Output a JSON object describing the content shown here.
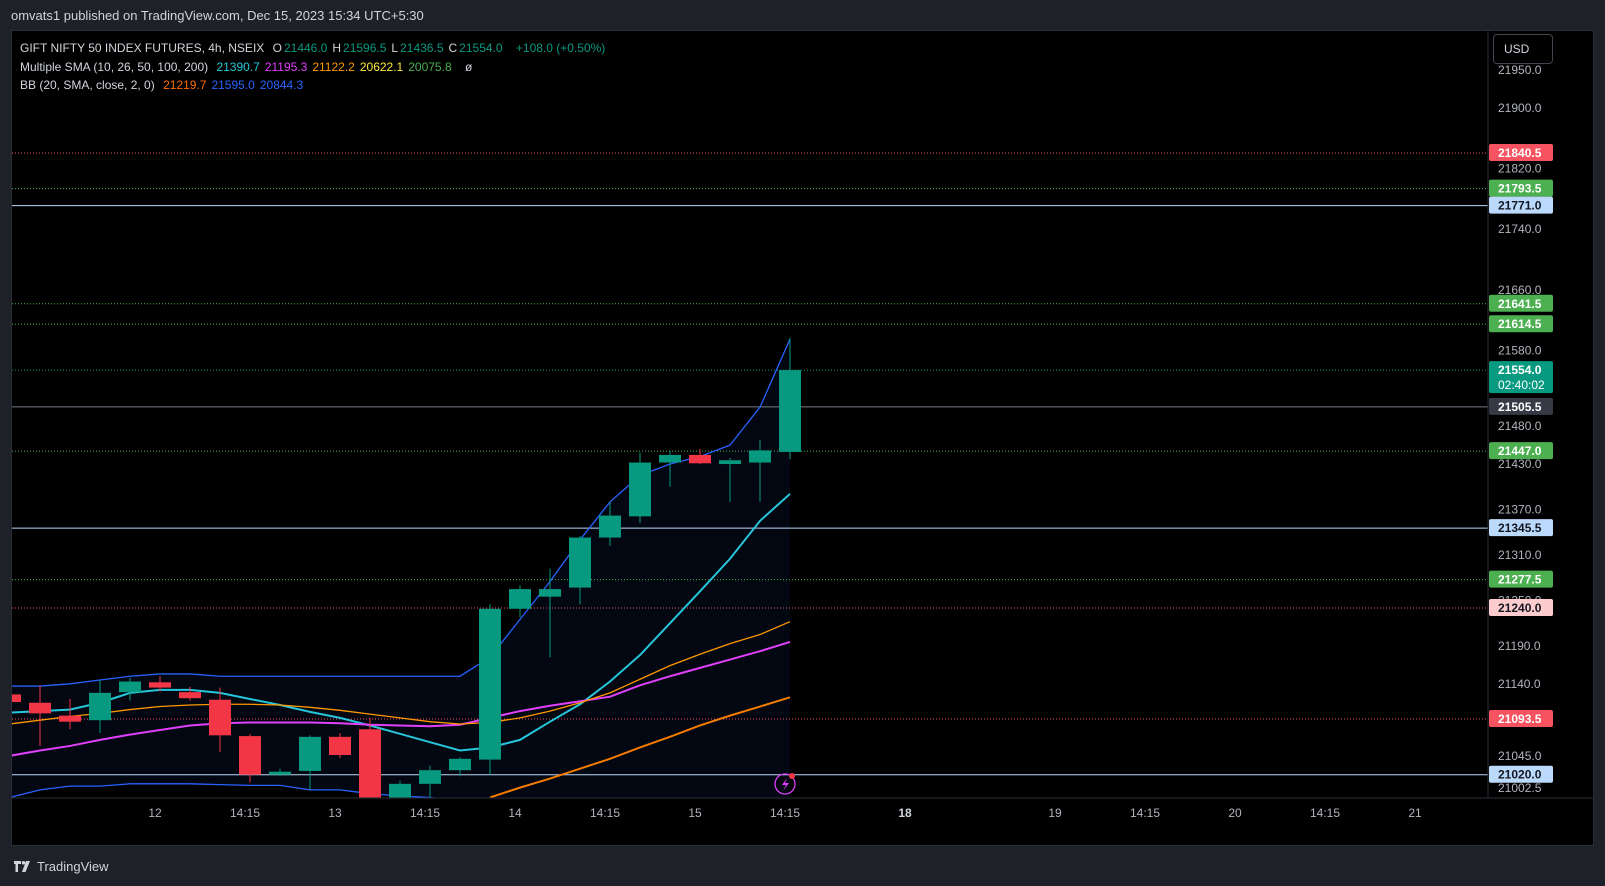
{
  "header": {
    "publisher_text": "omvats1 published on TradingView.com, Dec 15, 2023 15:34 UTC+5:30"
  },
  "legend": {
    "symbol": "GIFT NIFTY 50 INDEX FUTURES, 4h, NSEIX",
    "ohlc": [
      {
        "label": "O",
        "value": "21446.0"
      },
      {
        "label": "H",
        "value": "21596.5"
      },
      {
        "label": "L",
        "value": "21436.5"
      },
      {
        "label": "C",
        "value": "21554.0"
      }
    ],
    "change": "+108.0 (+0.50%)",
    "sma_label": "Multiple SMA (10, 26, 50, 100, 200)",
    "sma_values": [
      {
        "value": "21390.7",
        "color": "#26c6da"
      },
      {
        "value": "21195.3",
        "color": "#e040fb"
      },
      {
        "value": "21122.2",
        "color": "#ff9800"
      },
      {
        "value": "20622.1",
        "color": "#ffeb3b"
      },
      {
        "value": "20075.8",
        "color": "#4caf50"
      }
    ],
    "sma_extra": "ø",
    "bb_label": "BB (20, SMA, close, 2, 0)",
    "bb_values": [
      {
        "value": "21219.7",
        "color": "#ff6d00"
      },
      {
        "value": "21595.0",
        "color": "#2962ff"
      },
      {
        "value": "20844.3",
        "color": "#2962ff"
      }
    ]
  },
  "currency_button": "USD",
  "footer": {
    "brand": "TradingView"
  },
  "colors": {
    "up": "#089981",
    "down": "#f23645",
    "price_label": "#089981"
  },
  "chart_data": {
    "type": "candlestick",
    "timeframe": "4h",
    "ylim": [
      20985,
      21978
    ],
    "y_ticks": [
      "21950.0",
      "21900.0",
      "21820.0",
      "21740.0",
      "21660.0",
      "21580.0",
      "21480.0",
      "21430.0",
      "21370.0",
      "21310.0",
      "21250.0",
      "21190.0",
      "21140.0",
      "21045.0",
      "21002.5"
    ],
    "x_ticks": [
      "12",
      "14:15",
      "13",
      "14:15",
      "14",
      "14:15",
      "15",
      "14:15",
      "18",
      "19",
      "14:15",
      "20",
      "14:15",
      "21"
    ],
    "candles": [
      {
        "o": 21126,
        "h": 21135,
        "l": 21098,
        "c": 21116
      },
      {
        "o": 21115,
        "h": 21138,
        "l": 21058,
        "c": 21101
      },
      {
        "o": 21098,
        "h": 21120,
        "l": 21080,
        "c": 21090
      },
      {
        "o": 21092,
        "h": 21145,
        "l": 21075,
        "c": 21128
      },
      {
        "o": 21129,
        "h": 21148,
        "l": 21118,
        "c": 21143
      },
      {
        "o": 21142,
        "h": 21150,
        "l": 21130,
        "c": 21135
      },
      {
        "o": 21129,
        "h": 21136,
        "l": 21118,
        "c": 21121
      },
      {
        "o": 21119,
        "h": 21135,
        "l": 21050,
        "c": 21072
      },
      {
        "o": 21071,
        "h": 21074,
        "l": 21010,
        "c": 21020
      },
      {
        "o": 21020,
        "h": 21028,
        "l": 21018,
        "c": 21024
      },
      {
        "o": 21025,
        "h": 21072,
        "l": 21000,
        "c": 21070
      },
      {
        "o": 21070,
        "h": 21075,
        "l": 21042,
        "c": 21046
      },
      {
        "o": 21080,
        "h": 21095,
        "l": 20990,
        "c": 20990
      },
      {
        "o": 20990,
        "h": 21012,
        "l": 20985,
        "c": 21008
      },
      {
        "o": 21008,
        "h": 21032,
        "l": 20990,
        "c": 21026
      },
      {
        "o": 21026,
        "h": 21043,
        "l": 21018,
        "c": 21041
      },
      {
        "o": 21040,
        "h": 21245,
        "l": 21020,
        "c": 21239
      },
      {
        "o": 21239,
        "h": 21270,
        "l": 21228,
        "c": 21265
      },
      {
        "o": 21255,
        "h": 21292,
        "l": 21175,
        "c": 21265
      },
      {
        "o": 21267,
        "h": 21335,
        "l": 21245,
        "c": 21333
      },
      {
        "o": 21333,
        "h": 21380,
        "l": 21322,
        "c": 21362
      },
      {
        "o": 21361,
        "h": 21445,
        "l": 21352,
        "c": 21432
      },
      {
        "o": 21432,
        "h": 21448,
        "l": 21400,
        "c": 21442
      },
      {
        "o": 21442,
        "h": 21450,
        "l": 21430,
        "c": 21431
      },
      {
        "o": 21430,
        "h": 21438,
        "l": 21380,
        "c": 21435
      },
      {
        "o": 21432,
        "h": 21462,
        "l": 21380,
        "c": 21448
      },
      {
        "o": 21446,
        "h": 21596.5,
        "l": 21436.5,
        "c": 21554
      }
    ],
    "series": [
      {
        "name": "SMA 10",
        "color": "#26c6da",
        "values": [
          21102,
          21104,
          21106,
          21115,
          21128,
          21132,
          21132,
          21128,
          21120,
          21112,
          21103,
          21095,
          21085,
          21074,
          21063,
          21052,
          21056,
          21066,
          21090,
          21113,
          21143,
          21178,
          21220,
          21262,
          21305,
          21355,
          21390.7
        ]
      },
      {
        "name": "SMA 26",
        "color": "#e040fb",
        "values": [
          21045,
          21052,
          21058,
          21066,
          21073,
          21079,
          21085,
          21088,
          21089,
          21089,
          21089,
          21088,
          21086,
          21085,
          21084,
          21086,
          21095,
          21104,
          21111,
          21117,
          21123,
          21138,
          21150,
          21161,
          21172,
          21183,
          21195.3
        ]
      },
      {
        "name": "SMA 50",
        "color": "#ff9800",
        "values": [
          21087,
          21092,
          21097,
          21101,
          21106,
          21110,
          21112,
          21113,
          21113,
          21112,
          21109,
          21105,
          21100,
          21095,
          21090,
          21087,
          21089,
          21095,
          21104,
          21115,
          21128,
          21146,
          21164,
          21179,
          21193,
          21205,
          21222
        ]
      },
      {
        "name": "SMA 100",
        "color": "#f57c00",
        "values": [
          null,
          null,
          null,
          null,
          null,
          null,
          null,
          null,
          null,
          null,
          null,
          null,
          null,
          null,
          null,
          null,
          20990,
          21003,
          21015,
          21028,
          21041,
          21056,
          21070,
          21085,
          21098,
          21110,
          21122.2
        ]
      },
      {
        "name": "BB upper",
        "color": "#2962ff",
        "values": [
          21137,
          21137,
          21140,
          21145,
          21150,
          21153,
          21153,
          21150,
          21150,
          21150,
          21150,
          21150,
          21150,
          21150,
          21150,
          21150,
          21175,
          21225,
          21275,
          21330,
          21380,
          21415,
          21430,
          21440,
          21455,
          21505,
          21595
        ]
      },
      {
        "name": "BB lower",
        "color": "#2962ff",
        "values": [
          20990,
          21000,
          21005,
          21005,
          21008,
          21008,
          21008,
          21007,
          21006,
          21006,
          21000,
          21000,
          20995,
          20992,
          20990,
          20985,
          20985,
          20985,
          20985,
          20985,
          20985,
          20985,
          20985,
          20985,
          20985,
          20985,
          20985
        ]
      }
    ],
    "price_levels": [
      {
        "value": "21840.5",
        "style": "dotted",
        "line_color": "#f7525f",
        "bg": "#f7525f",
        "fg": "#ffffff"
      },
      {
        "value": "21793.5",
        "style": "dotted",
        "line_color": "#4caf50",
        "bg": "#4caf50",
        "fg": "#ffffff"
      },
      {
        "value": "21771.0",
        "style": "solid",
        "line_color": "#bbd9fb",
        "bg": "#bbd9fb",
        "fg": "#131722"
      },
      {
        "value": "21641.5",
        "style": "dotted",
        "line_color": "#4caf50",
        "bg": "#4caf50",
        "fg": "#ffffff"
      },
      {
        "value": "21614.5",
        "style": "dotted",
        "line_color": "#4caf50",
        "bg": "#4caf50",
        "fg": "#ffffff"
      },
      {
        "value": "21554.0",
        "style": "dotted",
        "line_color": "#089981",
        "bg": "#089981",
        "fg": "#ffffff",
        "countdown": "02:40:02"
      },
      {
        "value": "21505.5",
        "style": "solid",
        "line_color": "#787b86",
        "bg": "#363a45",
        "fg": "#ffffff"
      },
      {
        "value": "21447.0",
        "style": "dotted",
        "line_color": "#4caf50",
        "bg": "#4caf50",
        "fg": "#ffffff"
      },
      {
        "value": "21345.5",
        "style": "solid",
        "line_color": "#bbd9fb",
        "bg": "#bbd9fb",
        "fg": "#131722"
      },
      {
        "value": "21277.5",
        "style": "dotted",
        "line_color": "#4caf50",
        "bg": "#4caf50",
        "fg": "#ffffff"
      },
      {
        "value": "21240.0",
        "style": "dotted",
        "line_color": "#f7525f",
        "bg": "#fccbcd",
        "fg": "#131722"
      },
      {
        "value": "21093.5",
        "style": "dotted",
        "line_color": "#f7525f",
        "bg": "#f7525f",
        "fg": "#ffffff"
      },
      {
        "value": "21020.0",
        "style": "solid",
        "line_color": "#bbd9fb",
        "bg": "#bbd9fb",
        "fg": "#131722"
      }
    ]
  }
}
